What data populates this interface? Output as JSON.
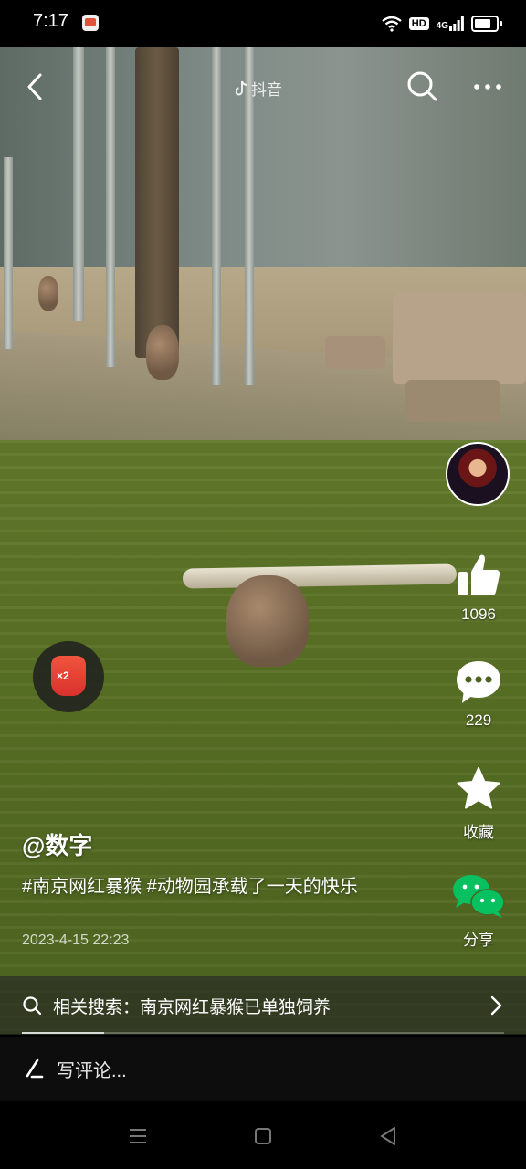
{
  "status_bar": {
    "time": "7:17",
    "hd_label": "HD",
    "network_label": "4G"
  },
  "top_bar": {
    "brand": "抖音",
    "icons": [
      "back-icon",
      "search-icon",
      "more-icon"
    ]
  },
  "reward_badge": {
    "multiplier": "×2"
  },
  "actions": {
    "like_count": "1096",
    "comment_count": "229",
    "favorite_label": "收藏",
    "share_label": "分享"
  },
  "post": {
    "author": "@数字",
    "caption": "#南京网红暴猴 #动物园承载了一天的快乐",
    "date": "2023-4-15 22:23"
  },
  "related_search": {
    "text": "相关搜索：南京网红暴猴已单独饲养"
  },
  "playback": {
    "progress": 0.17
  },
  "comment_bar": {
    "placeholder": "写评论..."
  },
  "colors": {
    "like_white": "#ffffff",
    "wechat_green": "#07c160",
    "badge_red": "#e23b33"
  }
}
